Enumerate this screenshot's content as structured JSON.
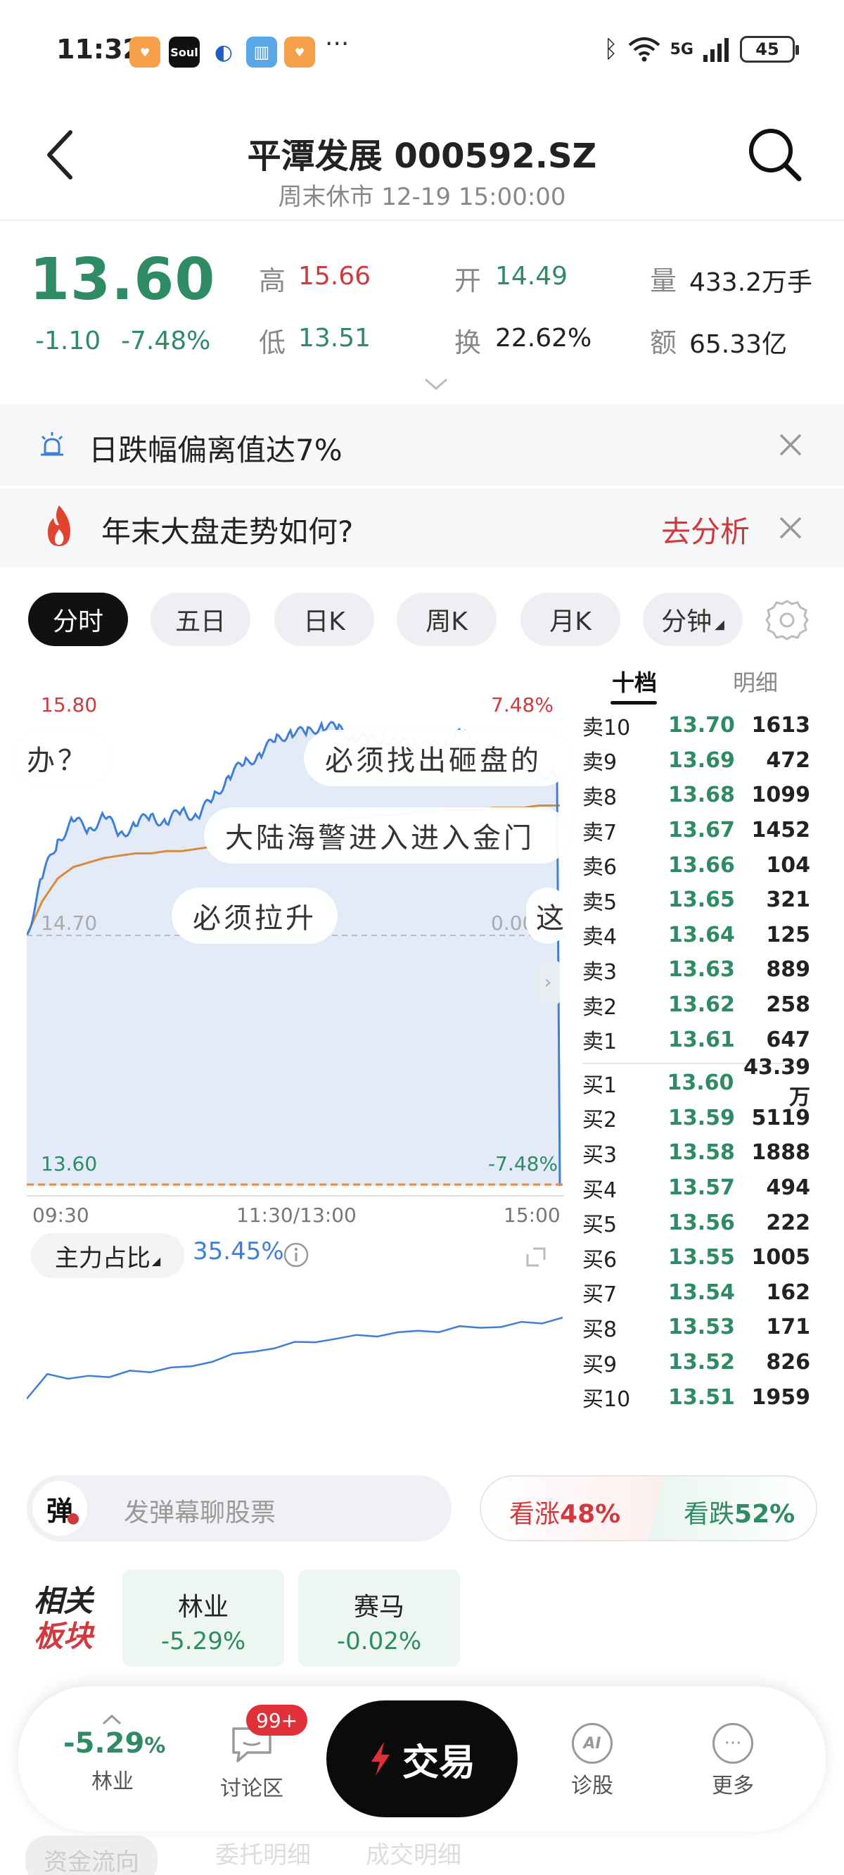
{
  "status_bar": {
    "time": "11:32",
    "apps": [
      "Soul"
    ],
    "more": "···",
    "network": "5G",
    "battery": "45"
  },
  "header": {
    "title": "平潭发展 000592.SZ",
    "subtitle": "周末休市 12-19 15:00:00"
  },
  "quote": {
    "price": "13.60",
    "change": "-1.10",
    "change_pct": "-7.48%",
    "high_label": "高",
    "high": "15.66",
    "low_label": "低",
    "low": "13.51",
    "open_label": "开",
    "open": "14.49",
    "turnover_label": "换",
    "turnover": "22.62%",
    "volume_label": "量",
    "volume": "433.2万手",
    "amount_label": "额",
    "amount": "65.33亿"
  },
  "alerts": [
    {
      "text": "日跌幅偏离值达7%"
    },
    {
      "text": "年末大盘走势如何?",
      "action": "去分析"
    }
  ],
  "tabs": [
    "分时",
    "五日",
    "日K",
    "周K",
    "月K",
    "分钟"
  ],
  "active_tab": "分时",
  "chart": {
    "price_top": "15.80",
    "pct_top": "7.48%",
    "price_mid": "14.70",
    "pct_mid": "0.00%",
    "price_bot": "13.60",
    "pct_bot": "-7.48%",
    "time_labels": [
      "09:30",
      "11:30/13:00",
      "15:00"
    ],
    "danmu": [
      "办？",
      "必须找出砸盘的",
      "大陆海警进入进入金门",
      "必须拉升",
      "这"
    ]
  },
  "chart_data": {
    "type": "line",
    "x_labels": [
      "09:30",
      "11:30/13:00",
      "15:00"
    ],
    "ylim": [
      13.6,
      15.8
    ],
    "series": [
      {
        "values": [
          14.7,
          14.95,
          15.12,
          15.2,
          15.17,
          15.22,
          15.15,
          15.18,
          15.23,
          15.19,
          15.25,
          15.22,
          15.3,
          15.4,
          15.45,
          15.5,
          15.55,
          15.6,
          15.58,
          15.63,
          15.6,
          15.58,
          15.55,
          15.57,
          15.53,
          15.56,
          15.52,
          15.55,
          15.58,
          15.55,
          15.5,
          15.48,
          15.45,
          15.42,
          15.4,
          13.6
        ]
      },
      {
        "values": [
          14.7,
          14.85,
          14.95,
          15.0,
          15.02,
          15.04,
          15.05,
          15.06,
          15.06,
          15.07,
          15.07,
          15.08,
          15.09,
          15.11,
          15.13,
          15.15,
          15.17,
          15.18,
          15.19,
          15.2,
          15.21,
          15.22,
          15.22,
          15.23,
          15.23,
          15.24,
          15.24,
          15.25,
          15.25,
          15.25,
          15.26,
          15.26,
          15.26,
          15.27,
          15.27,
          15.27
        ]
      }
    ]
  },
  "main_force": {
    "label": "主力占比",
    "value": "35.45%"
  },
  "main_force_data": [
    0.15,
    0.4,
    0.32,
    0.38,
    0.36,
    0.4,
    0.42,
    0.44,
    0.45,
    0.52,
    0.56,
    0.6,
    0.64,
    0.67,
    0.7,
    0.72,
    0.74,
    0.76,
    0.77,
    0.79,
    0.8,
    0.82,
    0.83,
    0.84,
    0.86,
    0.88,
    0.92
  ],
  "order_book": {
    "tabs": [
      "十档",
      "明细"
    ],
    "sell": [
      {
        "name": "卖10",
        "price": "13.70",
        "vol": "1613"
      },
      {
        "name": "卖9",
        "price": "13.69",
        "vol": "472"
      },
      {
        "name": "卖8",
        "price": "13.68",
        "vol": "1099"
      },
      {
        "name": "卖7",
        "price": "13.67",
        "vol": "1452"
      },
      {
        "name": "卖6",
        "price": "13.66",
        "vol": "104"
      },
      {
        "name": "卖5",
        "price": "13.65",
        "vol": "321"
      },
      {
        "name": "卖4",
        "price": "13.64",
        "vol": "125"
      },
      {
        "name": "卖3",
        "price": "13.63",
        "vol": "889"
      },
      {
        "name": "卖2",
        "price": "13.62",
        "vol": "258"
      },
      {
        "name": "卖1",
        "price": "13.61",
        "vol": "647"
      }
    ],
    "buy": [
      {
        "name": "买1",
        "price": "13.60",
        "vol": "43.39万"
      },
      {
        "name": "买2",
        "price": "13.59",
        "vol": "5119"
      },
      {
        "name": "买3",
        "price": "13.58",
        "vol": "1888"
      },
      {
        "name": "买4",
        "price": "13.57",
        "vol": "494"
      },
      {
        "name": "买5",
        "price": "13.56",
        "vol": "222"
      },
      {
        "name": "买6",
        "price": "13.55",
        "vol": "1005"
      },
      {
        "name": "买7",
        "price": "13.54",
        "vol": "162"
      },
      {
        "name": "买8",
        "price": "13.53",
        "vol": "171"
      },
      {
        "name": "买9",
        "price": "13.52",
        "vol": "826"
      },
      {
        "name": "买10",
        "price": "13.51",
        "vol": "1959"
      }
    ]
  },
  "danmu_input": {
    "badge": "弹",
    "placeholder": "发弹幕聊股票"
  },
  "vote": {
    "up": "看涨",
    "up_pct": "48%",
    "down": "看跌",
    "down_pct": "52%"
  },
  "sectors": {
    "title_line1": "相关",
    "title_line2": "板块",
    "items": [
      {
        "name": "林业",
        "pct": "-5.29%"
      },
      {
        "name": "赛马",
        "pct": "-0.02%"
      }
    ]
  },
  "bottom_nav": {
    "sector_pct": "-5.29",
    "sector_pct_unit": "%",
    "sector_label": "林业",
    "discuss_label": "讨论区",
    "discuss_badge": "99+",
    "trade_label": "交易",
    "diagnose_label": "诊股",
    "diagnose_icon_text": "AI",
    "more_label": "更多"
  },
  "below_tabs": [
    "资金流向",
    "委托明细",
    "成交明细"
  ],
  "colors": {
    "up": "#d0393e",
    "down": "#2e8b64",
    "price_line": "#3f7fd8",
    "avg_line": "#d98a3a"
  }
}
